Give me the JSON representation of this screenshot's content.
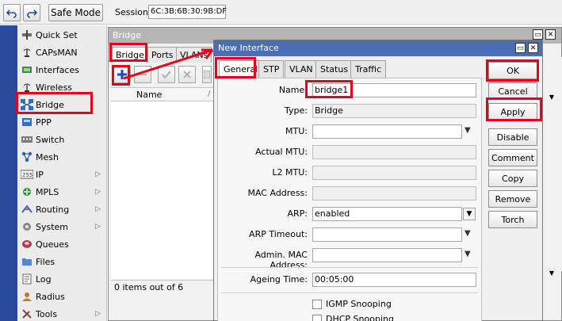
{
  "toolbar": {
    "undo_icon": "undo-icon",
    "redo_icon": "redo-icon",
    "safe_mode_label": "Safe Mode",
    "session_label": "Session:",
    "session_value": "6C:3B:6B:30:9B:DF"
  },
  "sidebar": {
    "items": [
      {
        "label": "Quick Set",
        "icon": "quick-set-icon",
        "submenu": false
      },
      {
        "label": "CAPsMAN",
        "icon": "capsman-icon",
        "submenu": false
      },
      {
        "label": "Interfaces",
        "icon": "interfaces-icon",
        "submenu": false
      },
      {
        "label": "Wireless",
        "icon": "wireless-icon",
        "submenu": false
      },
      {
        "label": "Bridge",
        "icon": "bridge-icon",
        "submenu": false
      },
      {
        "label": "PPP",
        "icon": "ppp-icon",
        "submenu": false
      },
      {
        "label": "Switch",
        "icon": "switch-icon",
        "submenu": false
      },
      {
        "label": "Mesh",
        "icon": "mesh-icon",
        "submenu": false
      },
      {
        "label": "IP",
        "icon": "ip-icon",
        "submenu": true
      },
      {
        "label": "MPLS",
        "icon": "mpls-icon",
        "submenu": true
      },
      {
        "label": "Routing",
        "icon": "routing-icon",
        "submenu": true
      },
      {
        "label": "System",
        "icon": "system-icon",
        "submenu": true
      },
      {
        "label": "Queues",
        "icon": "queues-icon",
        "submenu": false
      },
      {
        "label": "Files",
        "icon": "files-icon",
        "submenu": false
      },
      {
        "label": "Log",
        "icon": "log-icon",
        "submenu": false
      },
      {
        "label": "Radius",
        "icon": "radius-icon",
        "submenu": false
      },
      {
        "label": "Tools",
        "icon": "tools-icon",
        "submenu": true
      }
    ]
  },
  "bridge_window": {
    "title": "Bridge",
    "tabs": [
      "Bridge",
      "Ports",
      "VLANs"
    ],
    "column_name": "Name",
    "status": "0 items out of 6"
  },
  "dialog": {
    "title": "New Interface",
    "tabs": [
      "General",
      "STP",
      "VLAN",
      "Status",
      "Traffic"
    ],
    "fields": {
      "name_label": "Name:",
      "name_value": "bridge1",
      "type_label": "Type:",
      "type_value": "Bridge",
      "mtu_label": "MTU:",
      "mtu_value": "",
      "actual_mtu_label": "Actual MTU:",
      "actual_mtu_value": "",
      "l2_mtu_label": "L2 MTU:",
      "l2_mtu_value": "",
      "mac_label": "MAC Address:",
      "mac_value": "",
      "arp_label": "ARP:",
      "arp_value": "enabled",
      "arp_timeout_label": "ARP Timeout:",
      "arp_timeout_value": "",
      "admin_mac_label": "Admin. MAC Address:",
      "admin_mac_value": "",
      "ageing_label": "Ageing Time:",
      "ageing_value": "00:05:00",
      "igmp_label": "IGMP Snooping",
      "dhcp_label": "DHCP Snooping"
    },
    "buttons": {
      "ok": "OK",
      "cancel": "Cancel",
      "apply": "Apply",
      "disable": "Disable",
      "comment": "Comment",
      "copy": "Copy",
      "remove": "Remove",
      "torch": "Torch"
    }
  },
  "colors": {
    "highlight": "#e8001c",
    "dialog_title_bg": "#4a6db5",
    "sidebar_strip": "#2b4a99"
  }
}
